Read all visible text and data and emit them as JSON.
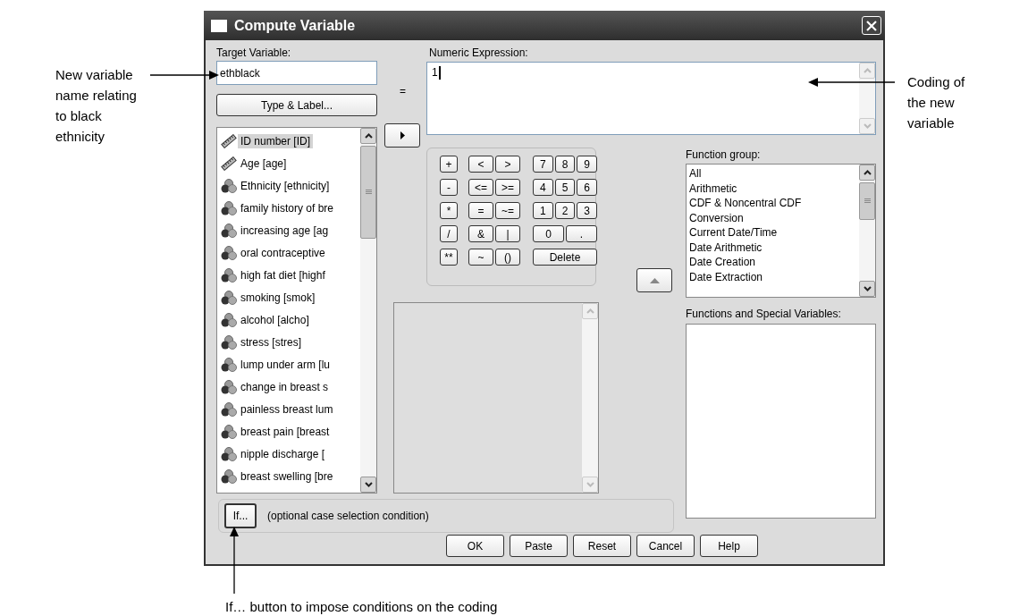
{
  "annotations": {
    "left": "New variable name relating to black ethnicity",
    "right": "Coding of the new variable",
    "bottom": "If… button to impose conditions on the coding"
  },
  "window": {
    "title": "Compute Variable"
  },
  "target_variable": {
    "label": "Target Variable:",
    "value": "ethblack"
  },
  "type_label_button": "Type & Label...",
  "equals": "=",
  "numeric_expression": {
    "label": "Numeric Expression:",
    "value": "1"
  },
  "variables": [
    {
      "name": "ID number [ID]",
      "kind": "scale",
      "selected": true
    },
    {
      "name": "Age [age]",
      "kind": "scale",
      "selected": false
    },
    {
      "name": "Ethnicity [ethnicity]",
      "kind": "nominal",
      "selected": false
    },
    {
      "name": "family history of bre",
      "kind": "nominal",
      "selected": false
    },
    {
      "name": "increasing age [ag",
      "kind": "nominal",
      "selected": false
    },
    {
      "name": "oral contraceptive",
      "kind": "nominal",
      "selected": false
    },
    {
      "name": "high fat diet [highf",
      "kind": "nominal",
      "selected": false
    },
    {
      "name": "smoking [smok]",
      "kind": "nominal",
      "selected": false
    },
    {
      "name": "alcohol [alcho]",
      "kind": "nominal",
      "selected": false
    },
    {
      "name": "stress [stres]",
      "kind": "nominal",
      "selected": false
    },
    {
      "name": "lump under arm [lu",
      "kind": "nominal",
      "selected": false
    },
    {
      "name": "change in breast s",
      "kind": "nominal",
      "selected": false
    },
    {
      "name": "painless breast lum",
      "kind": "nominal",
      "selected": false
    },
    {
      "name": "breast pain [breast",
      "kind": "nominal",
      "selected": false
    },
    {
      "name": "nipple discharge [",
      "kind": "nominal",
      "selected": false
    },
    {
      "name": "breast swelling [bre",
      "kind": "nominal",
      "selected": false
    }
  ],
  "keypad": {
    "operators": [
      [
        "+",
        "<",
        ">"
      ],
      [
        "-",
        "<=",
        ">="
      ],
      [
        "*",
        "=",
        "~="
      ],
      [
        "/",
        "&",
        "|"
      ],
      [
        "**",
        "~",
        "()"
      ]
    ],
    "digits": [
      [
        "7",
        "8",
        "9"
      ],
      [
        "4",
        "5",
        "6"
      ],
      [
        "1",
        "2",
        "3"
      ],
      [
        "0",
        "."
      ],
      [
        "Delete"
      ]
    ]
  },
  "function_group": {
    "label": "Function group:",
    "items": [
      {
        "name": "All",
        "selected": false
      },
      {
        "name": "Arithmetic",
        "selected": false
      },
      {
        "name": "CDF & Noncentral CDF",
        "selected": false
      },
      {
        "name": "Conversion",
        "selected": false
      },
      {
        "name": "Current Date/Time",
        "selected": false
      },
      {
        "name": "Date Arithmetic",
        "selected": false
      },
      {
        "name": "Date Creation",
        "selected": false
      },
      {
        "name": "Date Extraction",
        "selected": false
      }
    ]
  },
  "functions_label": "Functions and Special Variables:",
  "if_row": {
    "button": "If...",
    "note": "(optional case selection condition)"
  },
  "buttons": [
    "OK",
    "Paste",
    "Reset",
    "Cancel",
    "Help"
  ]
}
